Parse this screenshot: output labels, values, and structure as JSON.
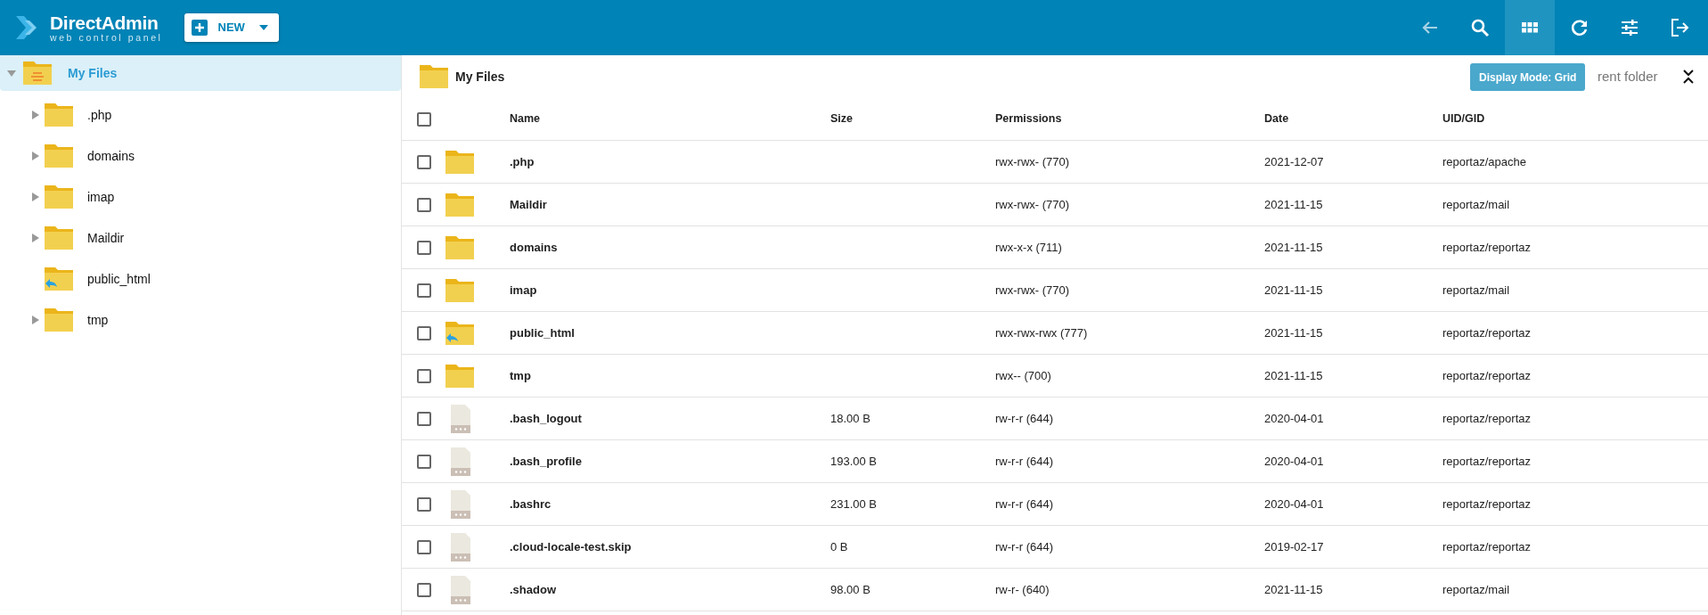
{
  "header": {
    "logo_title": "DirectAdmin",
    "logo_subtitle": "web control panel",
    "new_button": "NEW",
    "toolbar": [
      {
        "kind": "back",
        "selected": false,
        "disabled": true
      },
      {
        "kind": "search",
        "selected": false,
        "disabled": false
      },
      {
        "kind": "grid",
        "selected": true,
        "disabled": false
      },
      {
        "kind": "refresh",
        "selected": false,
        "disabled": false
      },
      {
        "kind": "settings",
        "selected": false,
        "disabled": false
      },
      {
        "kind": "logout",
        "selected": false,
        "disabled": false
      }
    ]
  },
  "tooltip": "Display Mode: Grid",
  "sidebar": {
    "root": {
      "label": "My Files",
      "selected": true,
      "expanded": true,
      "children": [
        {
          "label": ".php",
          "kind": "folder",
          "expandable": true,
          "selected": false
        },
        {
          "label": "domains",
          "kind": "folder",
          "expandable": true,
          "selected": false
        },
        {
          "label": "imap",
          "kind": "folder",
          "expandable": true,
          "selected": false
        },
        {
          "label": "Maildir",
          "kind": "folder",
          "expandable": true,
          "selected": false
        },
        {
          "label": "public_html",
          "kind": "link",
          "expandable": false,
          "selected": false
        },
        {
          "label": "tmp",
          "kind": "folder",
          "expandable": true,
          "selected": false
        }
      ]
    }
  },
  "breadcrumb": "My Files",
  "search": {
    "placeholder": "rent folder"
  },
  "table": {
    "header_checked": false,
    "columns": [
      "Name",
      "Size",
      "Permissions",
      "Date",
      "UID/GID"
    ],
    "rows": [
      {
        "kind": "folder",
        "checked": false,
        "name": ".php",
        "permissions": "rwx-rwx- (770)",
        "date": "2021-12-07",
        "uid_gid": "reportaz/apache"
      },
      {
        "kind": "folder",
        "checked": false,
        "name": "Maildir",
        "permissions": "rwx-rwx- (770)",
        "date": "2021-11-15",
        "uid_gid": "reportaz/mail"
      },
      {
        "kind": "folder",
        "checked": false,
        "name": "domains",
        "permissions": "rwx-x-x (711)",
        "date": "2021-11-15",
        "uid_gid": "reportaz/reportaz"
      },
      {
        "kind": "folder",
        "checked": false,
        "name": "imap",
        "permissions": "rwx-rwx- (770)",
        "date": "2021-11-15",
        "uid_gid": "reportaz/mail"
      },
      {
        "kind": "link",
        "checked": false,
        "name": "public_html",
        "permissions": "rwx-rwx-rwx (777)",
        "date": "2021-11-15",
        "uid_gid": "reportaz/reportaz"
      },
      {
        "kind": "folder",
        "checked": false,
        "name": "tmp",
        "permissions": "rwx-- (700)",
        "date": "2021-11-15",
        "uid_gid": "reportaz/reportaz"
      },
      {
        "kind": "file",
        "checked": false,
        "name": ".bash_logout",
        "size": "18.00 B",
        "permissions": "rw-r-r (644)",
        "date": "2020-04-01",
        "uid_gid": "reportaz/reportaz"
      },
      {
        "kind": "file",
        "checked": false,
        "name": ".bash_profile",
        "size": "193.00 B",
        "permissions": "rw-r-r (644)",
        "date": "2020-04-01",
        "uid_gid": "reportaz/reportaz"
      },
      {
        "kind": "file",
        "checked": false,
        "name": ".bashrc",
        "size": "231.00 B",
        "permissions": "rw-r-r (644)",
        "date": "2020-04-01",
        "uid_gid": "reportaz/reportaz"
      },
      {
        "kind": "file",
        "checked": false,
        "name": ".cloud-locale-test.skip",
        "size": "0 B",
        "permissions": "rw-r-r (644)",
        "date": "2019-02-17",
        "uid_gid": "reportaz/reportaz"
      },
      {
        "kind": "file",
        "checked": false,
        "name": ".shadow",
        "size": "98.00 B",
        "permissions": "rw-r- (640)",
        "date": "2021-11-15",
        "uid_gid": "reportaz/mail"
      }
    ]
  }
}
